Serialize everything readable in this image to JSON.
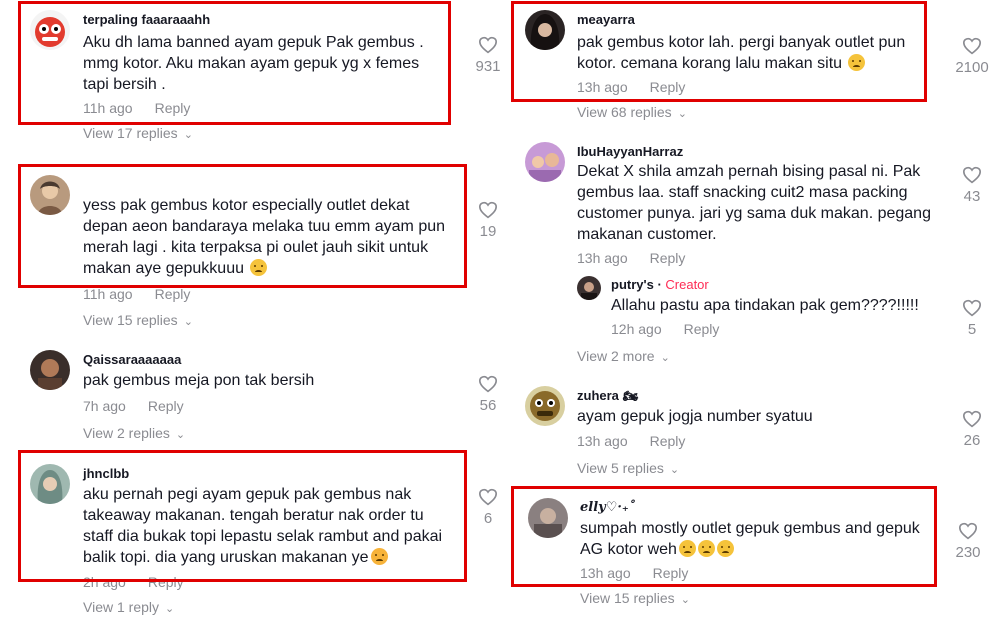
{
  "left": [
    {
      "username": "terpaling faaaraaahh",
      "lines": [
        "Aku dh lama banned ayam gepuk Pak gembus .",
        "mmg kotor. Aku makan ayam gepuk yg x femes",
        "tapi bersih ."
      ],
      "time": "11h ago",
      "reply": "Reply",
      "view": "View 17 replies",
      "likes": "931"
    },
    {
      "username": "​",
      "lines": [
        "yess pak gembus kotor especially outlet dekat",
        "depan aeon bandaraya melaka tuu emm ayam pun",
        "merah lagi . kita terpaksa pi oulet jauh sikit untuk",
        "makan aye gepukkuuu"
      ],
      "time": "11h ago",
      "reply": "Reply",
      "view": "View 15 replies",
      "likes": "19"
    },
    {
      "username": "Qaissaraaaaaaa",
      "lines": [
        "pak gembus meja pon tak bersih"
      ],
      "time": "7h ago",
      "reply": "Reply",
      "view": "View 2 replies",
      "likes": "56"
    },
    {
      "username": "jhnclbb",
      "lines": [
        "aku pernah pegi ayam gepuk pak gembus nak",
        "takeaway makanan. tengah beratur nak order tu",
        "staff dia bukak topi lepastu selak rambut and pakai",
        "balik topi. dia yang uruskan makanan ye"
      ],
      "time": "2h ago",
      "reply": "Reply",
      "view": "View 1 reply",
      "likes": "6"
    }
  ],
  "right": [
    {
      "username": "meayarra",
      "lines": [
        "pak gembus kotor lah. pergi banyak outlet pun",
        "kotor. cemana korang lalu makan situ"
      ],
      "time": "13h ago",
      "reply": "Reply",
      "view": "View 68 replies",
      "likes": "2100"
    },
    {
      "username": "IbuHayyanHarraz",
      "lines": [
        "Dekat X shila amzah pernah bising pasal ni. Pak",
        "gembus laa. staff snacking cuit2 masa packing",
        "customer punya. jari yg sama duk makan. pegang",
        "makanan customer."
      ],
      "time": "13h ago",
      "reply": "Reply",
      "likes": "43"
    },
    {
      "username": "putry's",
      "creator": "Creator",
      "lines": [
        "Allahu pastu apa tindakan pak gem????!!!!!"
      ],
      "time": "12h ago",
      "reply": "Reply",
      "view": "View 2 more",
      "likes": "5"
    },
    {
      "username": "zuhera",
      "lines": [
        "ayam gepuk jogja number syatuu"
      ],
      "time": "13h ago",
      "reply": "Reply",
      "view": "View 5 replies",
      "likes": "26"
    },
    {
      "username": "elly♡·₊˚",
      "lines": [
        "sumpah mostly outlet gepuk gembus and gepuk",
        "AG kotor weh"
      ],
      "time": "13h ago",
      "reply": "Reply",
      "view": "View 15 replies",
      "likes": "230"
    }
  ],
  "colors": {
    "highlight": "#e00000",
    "secondary_text": "#8a8b91",
    "creator": "#fe2c55"
  },
  "icons": {
    "like": "heart-outline-icon",
    "expand": "chevron-down-icon"
  }
}
